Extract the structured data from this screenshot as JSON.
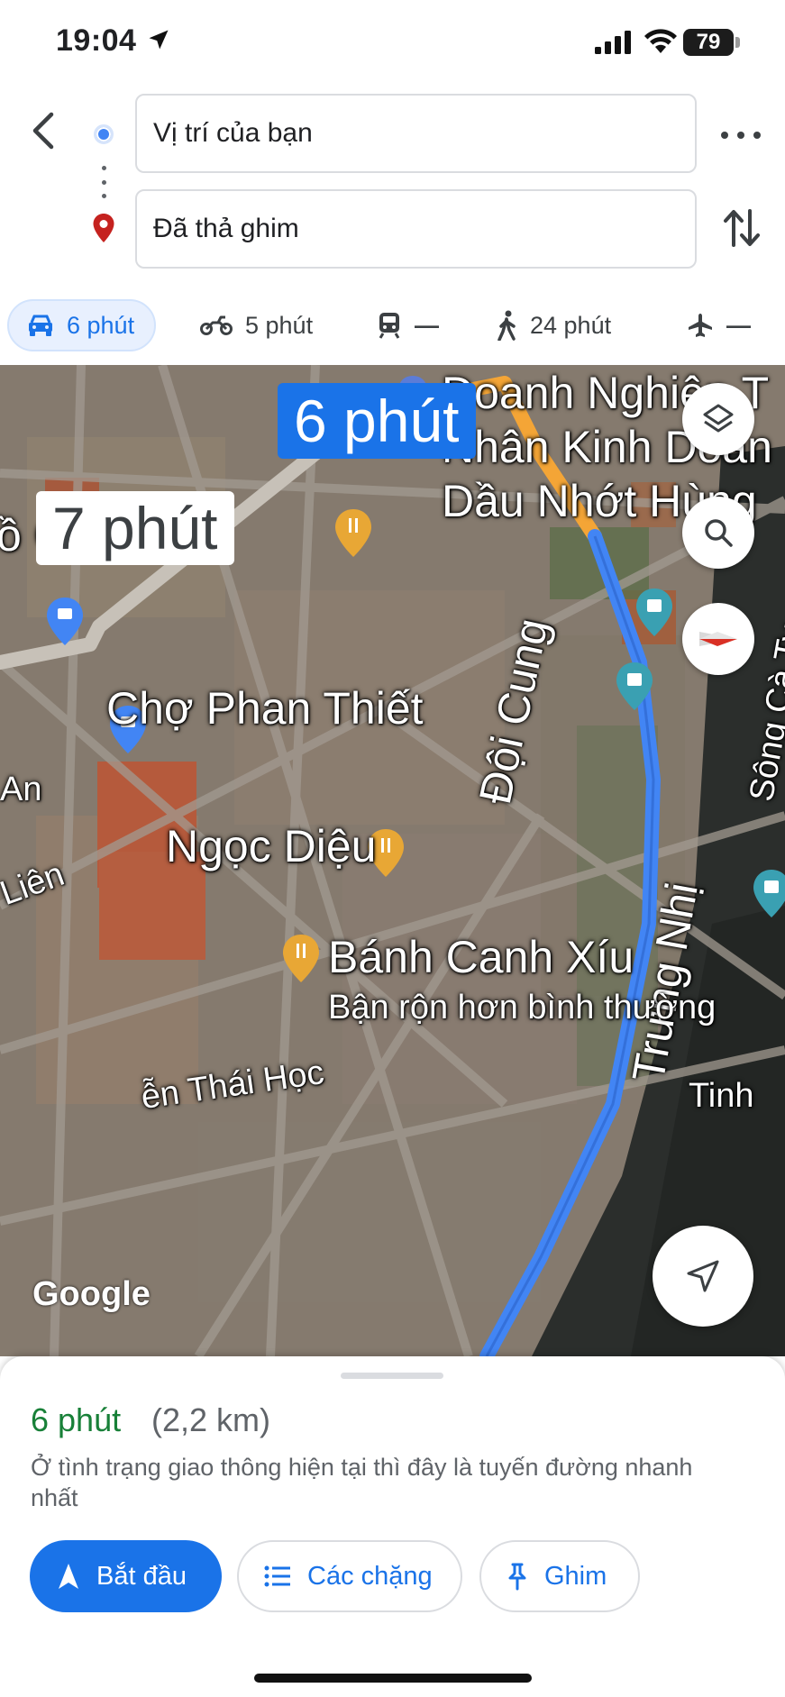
{
  "status_bar": {
    "time": "19:04",
    "battery": "79"
  },
  "directions": {
    "origin_value": "Vị trí của bạn",
    "destination_value": "Đã thả ghim"
  },
  "modes": [
    {
      "icon": "car-icon",
      "label": "6 phút",
      "selected": true
    },
    {
      "icon": "motorbike-icon",
      "label": "5 phút"
    },
    {
      "icon": "transit-icon",
      "label": "—"
    },
    {
      "icon": "walk-icon",
      "label": "24 phút"
    },
    {
      "icon": "flight-icon",
      "label": "—"
    }
  ],
  "map": {
    "route_time_primary": "6 phút",
    "route_time_alt": "7 phút",
    "labels": {
      "business_1": "Doanh Nghiệp T",
      "business_2": "Nhân Kinh Doan",
      "business_3": "Dầu Nhớt Hùng",
      "co_nhan": "ồ Cô Nhàn",
      "cho_phan_thiet": "Chợ Phan Thiết",
      "doi_cung": "Đội Cung",
      "trung_nhi": "Trưng Nhị",
      "ngoc_dieu": "Ngọc Diệu",
      "banh_canh": "Bánh Canh Xíu",
      "banh_canh_status": "Bận rộn hơn bình thường",
      "thai_hoc": "ễn Thái Học",
      "an": "An",
      "lien": "Liên",
      "song_ca_ty": "Sông Cà Ty",
      "tinh": "Tinh",
      "google": "Google"
    },
    "colors": {
      "route_blue": "#4285f4",
      "route_orange": "#f4a536",
      "alt_route": "#bdb6ac"
    }
  },
  "sheet": {
    "duration": "6 phút",
    "distance": "(2,2 km)",
    "note": "Ở tình trạng giao thông hiện tại thì đây là tuyến đường nhanh nhất",
    "start_label": "Bắt đầu",
    "stops_label": "Các chặng",
    "pin_label": "Ghim"
  }
}
